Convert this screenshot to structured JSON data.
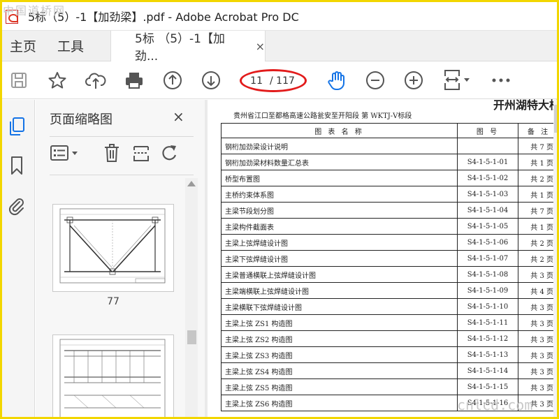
{
  "window": {
    "title": "5标（5）-1【加劲梁】.pdf - Adobe Acrobat Pro DC",
    "watermark": "中国道桥网"
  },
  "tabs": {
    "home": "主页",
    "tools": "工具",
    "document_tab": "5标 （5）-1【加劲...",
    "close_glyph": "×"
  },
  "toolbar": {
    "icons": [
      "save-icon",
      "star-icon",
      "cloud-upload-icon",
      "print-icon",
      "previous-page-icon",
      "next-page-icon",
      "hand-tool-icon",
      "zoom-out-icon",
      "zoom-in-icon",
      "fit-page-icon",
      "more-icon"
    ],
    "current_page": "11",
    "total_pages": "/ 117",
    "accent_color": "#1473e6",
    "highlight_color": "#e21b1b"
  },
  "left_rail": {
    "icons": [
      "pages-icon",
      "bookmark-icon",
      "attachment-icon"
    ]
  },
  "thumbnail_panel": {
    "title": "页面缩略图",
    "close_glyph": "×",
    "tools": [
      "options-icon",
      "delete-icon",
      "extract-icon",
      "rotate-icon"
    ],
    "thumbnails": [
      {
        "page_label": "77"
      },
      {
        "page_label": ""
      }
    ]
  },
  "document": {
    "top_title": "开州湖特大桥",
    "project_line": "贵州省江口至都格高速公路瓮安至开阳段   第 WKTJ-Ⅴ标段",
    "columns": [
      "图 表 名 称",
      "图 号",
      "备 注"
    ],
    "rows": [
      {
        "name": "钢桁加劲梁设计说明",
        "code": "",
        "note": "共 7 页"
      },
      {
        "name": "钢桁加劲梁材料数量汇总表",
        "code": "S4-1-5-1-01",
        "note": "共 1 页"
      },
      {
        "name": "桥型布置图",
        "code": "S4-1-5-1-02",
        "note": "共 2 页"
      },
      {
        "name": "主桥约束体系图",
        "code": "S4-1-5-1-03",
        "note": "共 1 页"
      },
      {
        "name": "主梁节段划分图",
        "code": "S4-1-5-1-04",
        "note": "共 7 页"
      },
      {
        "name": "主梁构件截面表",
        "code": "S4-1-5-1-05",
        "note": "共 1 页"
      },
      {
        "name": "主梁上弦焊缝设计图",
        "code": "S4-1-5-1-06",
        "note": "共 2 页"
      },
      {
        "name": "主梁下弦焊缝设计图",
        "code": "S4-1-5-1-07",
        "note": "共 2 页"
      },
      {
        "name": "主梁普通横联上弦焊缝设计图",
        "code": "S4-1-5-1-08",
        "note": "共 3 页"
      },
      {
        "name": "主梁端横联上弦焊缝设计图",
        "code": "S4-1-5-1-09",
        "note": "共 4 页"
      },
      {
        "name": "主梁横联下弦焊缝设计图",
        "code": "S4-1-5-1-10",
        "note": "共 3 页"
      },
      {
        "name": "主梁上弦 ZS1 构造图",
        "code": "S4-1-5-1-11",
        "note": "共 3 页"
      },
      {
        "name": "主梁上弦 ZS2 构造图",
        "code": "S4-1-5-1-12",
        "note": "共 3 页"
      },
      {
        "name": "主梁上弦 ZS3 构造图",
        "code": "S4-1-5-1-13",
        "note": "共 3 页"
      },
      {
        "name": "主梁上弦 ZS4 构造图",
        "code": "S4-1-5-1-14",
        "note": "共 3 页"
      },
      {
        "name": "主梁上弦 ZS5 构造图",
        "code": "S4-1-5-1-15",
        "note": "共 3 页"
      },
      {
        "name": "主梁上弦 ZS6 构造图",
        "code": "S4-1-5-1-16",
        "note": "共 3 页"
      }
    ],
    "site_watermark": "cnlcd.com"
  }
}
